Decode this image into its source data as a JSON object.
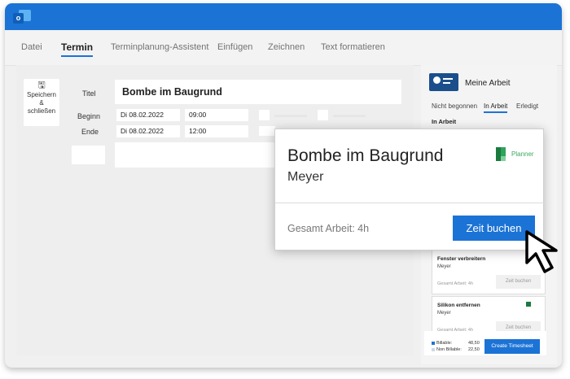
{
  "app": {
    "logo_letter": "o"
  },
  "ribbon": {
    "tabs": [
      {
        "label": "Datei"
      },
      {
        "label": "Termin"
      },
      {
        "label": "Terminplanung-Assistent"
      },
      {
        "label": "Einfügen"
      },
      {
        "label": "Zeichnen"
      },
      {
        "label": "Text formatieren"
      }
    ],
    "active_tab": "Termin"
  },
  "editor": {
    "save_button": {
      "line1": "Speichern",
      "line2": "&",
      "line3": "schließen"
    },
    "title_label": "Titel",
    "title_value": "Bombe im Baugrund",
    "begin_label": "Beginn",
    "begin_date": "Di 08.02.2022",
    "begin_time": "09:00",
    "end_label": "Ende",
    "end_date": "Di 08.02.2022",
    "end_time": "12:00"
  },
  "sidebar": {
    "title": "Meine Arbeit",
    "tabs": [
      "Nicht begonnen",
      "In Arbeit",
      "Erledigt"
    ],
    "active_tab": "In Arbeit",
    "section_heading": "In Arbeit",
    "cards": [
      {
        "title": "Fenster verbreitern",
        "owner": "Meyer",
        "total": "Gesamt Arbeit: 4h",
        "button": "Zeit buchen"
      },
      {
        "title": "Silikon entfernen",
        "owner": "Meyer",
        "total": "Gesamt Arbeit: 4h",
        "button": "Zeit buchen"
      }
    ],
    "footer": {
      "billable_label": "Billable:",
      "billable_value": "48,50",
      "non_billable_label": "Non Billable:",
      "non_billable_value": "22,50",
      "create_button": "Create Timesheet"
    }
  },
  "popup": {
    "title": "Bombe im Baugrund",
    "owner": "Meyer",
    "source": "Planner",
    "total_work": "Gesamt Arbeit: 4h",
    "book_button": "Zeit buchen"
  },
  "colors": {
    "accent": "#1c73d6",
    "title_bar": "#1c73d6",
    "planner_green": "#1b7a3e"
  }
}
